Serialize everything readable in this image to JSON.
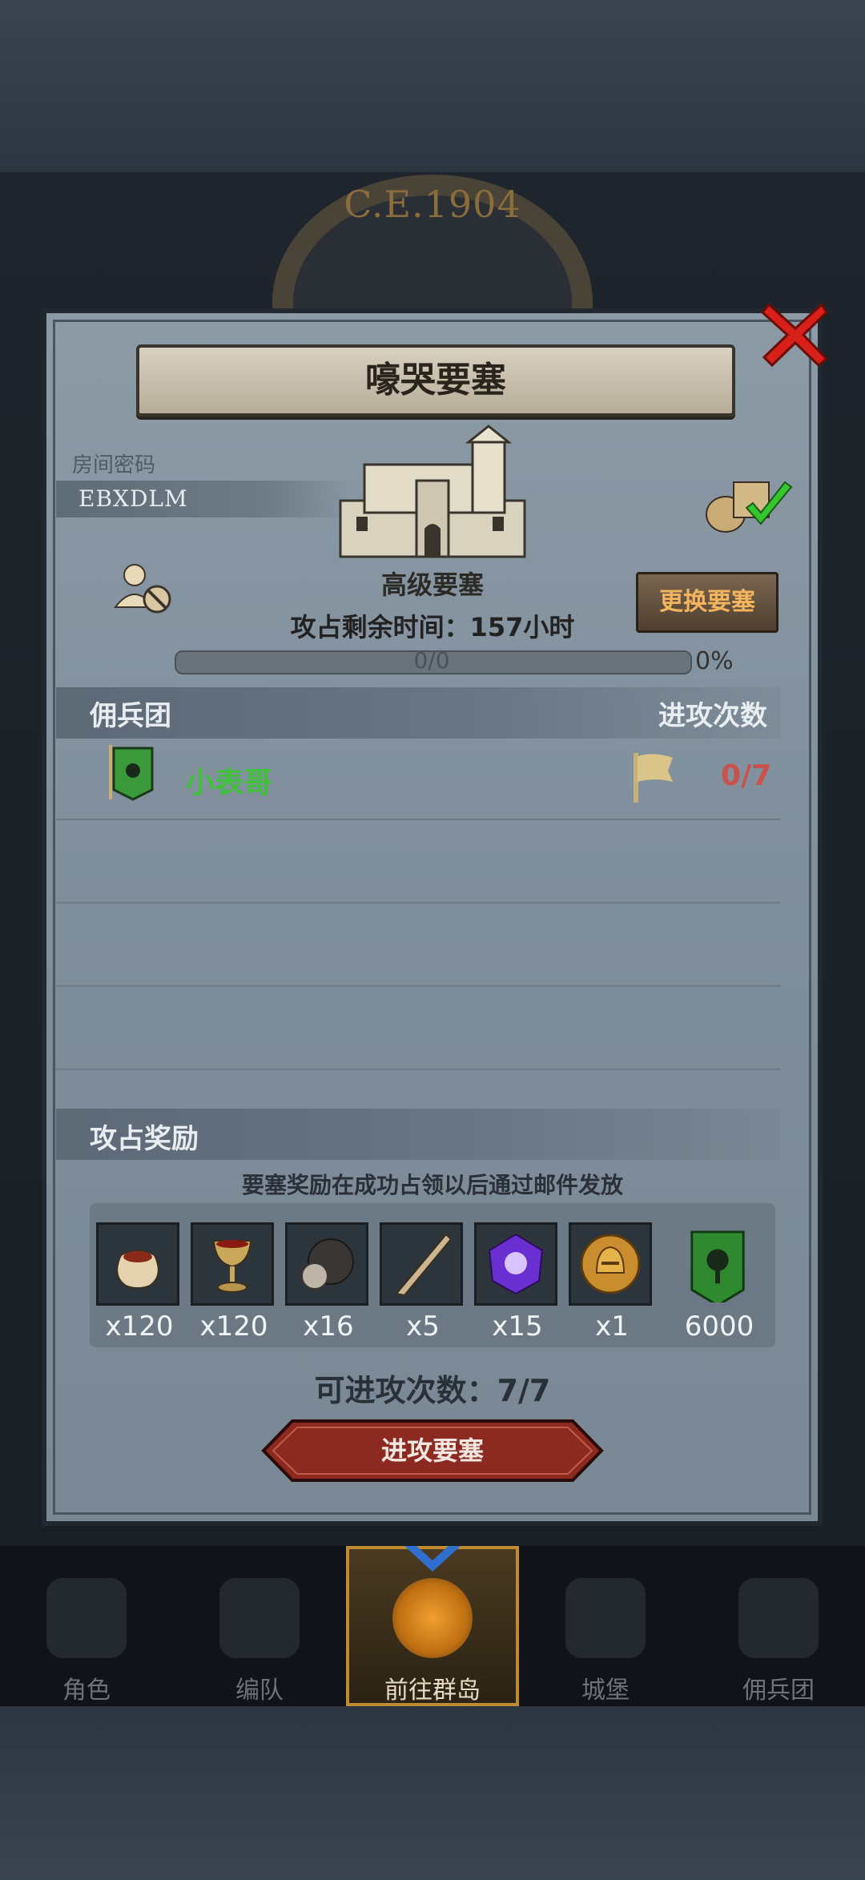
{
  "header": {
    "era": "C.E.1904"
  },
  "dialog": {
    "title": "嚎哭要塞",
    "room_label": "房间密码",
    "room_code": "EBXDLM",
    "fortress_type": "高级要塞",
    "timer_text": "攻占剩余时间：157小时",
    "swap_button": "更换要塞",
    "progress": {
      "text": "0/0",
      "percent_label": "0%",
      "fraction": 0
    },
    "mercenary_section": {
      "left": "佣兵团",
      "right": "进攻次数"
    },
    "mercenaries": [
      {
        "name": "小表哥",
        "attacks": "0/7"
      }
    ],
    "reward_section": {
      "title": "攻占奖励",
      "note": "要塞奖励在成功占领以后通过邮件发放"
    },
    "rewards": [
      {
        "icon": "pouch-icon",
        "qty": "x120"
      },
      {
        "icon": "goblet-icon",
        "qty": "x120"
      },
      {
        "icon": "ore-icon",
        "qty": "x16"
      },
      {
        "icon": "horn-icon",
        "qty": "x5"
      },
      {
        "icon": "purple-gem-icon",
        "qty": "x15"
      },
      {
        "icon": "gold-helmet-medal-icon",
        "qty": "x1"
      },
      {
        "icon": "guild-banner-icon",
        "qty": "6000"
      }
    ],
    "remaining_attacks": "可进攻次数：7/7",
    "attack_button": "进攻要塞"
  },
  "nav": {
    "items": [
      {
        "label": "角色",
        "active": false
      },
      {
        "label": "编队",
        "active": false
      },
      {
        "label": "前往群岛",
        "active": true
      },
      {
        "label": "城堡",
        "active": false
      },
      {
        "label": "佣兵团",
        "active": false
      }
    ]
  },
  "colors": {
    "guild_name": "#3fc13a",
    "attack_count": "#c9524d",
    "swap_button_text": "#f3b45e",
    "close_red": "#d8201a"
  }
}
